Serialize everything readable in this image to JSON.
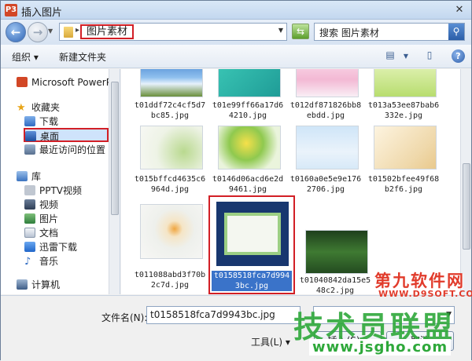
{
  "window": {
    "title": "插入图片",
    "app_icon": "P3",
    "close_glyph": "✕"
  },
  "address": {
    "breadcrumb": "图片素材",
    "search_placeholder": "搜索 图片素材"
  },
  "toolbar": {
    "organize": "组织 ▾",
    "new_folder": "新建文件夹"
  },
  "nav": {
    "items": [
      {
        "label": "Microsoft PowerPo",
        "icon": "powerpoint-icon"
      },
      {
        "label": "收藏夹",
        "icon": "star-icon"
      },
      {
        "label": "下载",
        "icon": "download-folder-icon"
      },
      {
        "label": "桌面",
        "icon": "desktop-icon"
      },
      {
        "label": "最近访问的位置",
        "icon": "recent-places-icon"
      },
      {
        "label": "库",
        "icon": "library-icon"
      },
      {
        "label": "PPTV视频",
        "icon": "pptv-icon"
      },
      {
        "label": "视频",
        "icon": "video-icon"
      },
      {
        "label": "图片",
        "icon": "pictures-icon"
      },
      {
        "label": "文档",
        "icon": "documents-icon"
      },
      {
        "label": "迅雷下载",
        "icon": "thunder-icon"
      },
      {
        "label": "音乐",
        "icon": "music-icon"
      },
      {
        "label": "计算机",
        "icon": "computer-icon"
      }
    ]
  },
  "files": [
    {
      "name": "t01ddf72c4cf5d7bc85.jpg"
    },
    {
      "name": "t01e99ff66a17d64210.jpg"
    },
    {
      "name": "t012df871826bb8ebdd.jpg"
    },
    {
      "name": "t013a53ee87bab6332e.jpg"
    },
    {
      "name": "t015bffcd4635c6964d.jpg"
    },
    {
      "name": "t0146d06acd6e2d9461.jpg"
    },
    {
      "name": "t0160a0e5e9e1762706.jpg"
    },
    {
      "name": "t01502bfee49f68b2f6.jpg"
    },
    {
      "name": "t011088abd3f70b2c7d.jpg"
    },
    {
      "name": "t0158518fca7d9943bc.jpg"
    },
    {
      "name": "t01040842da15e548c2.jpg"
    }
  ],
  "bottom": {
    "filename_label": "文件名(N):",
    "filename_value": "t0158518fca7d9943bc.jpg",
    "tools": "工具(L) ▾",
    "insert": "插入(S) ▾",
    "cancel": "取消"
  },
  "watermark": {
    "line1": "第九软件网",
    "line1b": "WWW.D9SOFT.COM",
    "line2": "技术员联盟",
    "line2b": "www.jsgho.com"
  }
}
